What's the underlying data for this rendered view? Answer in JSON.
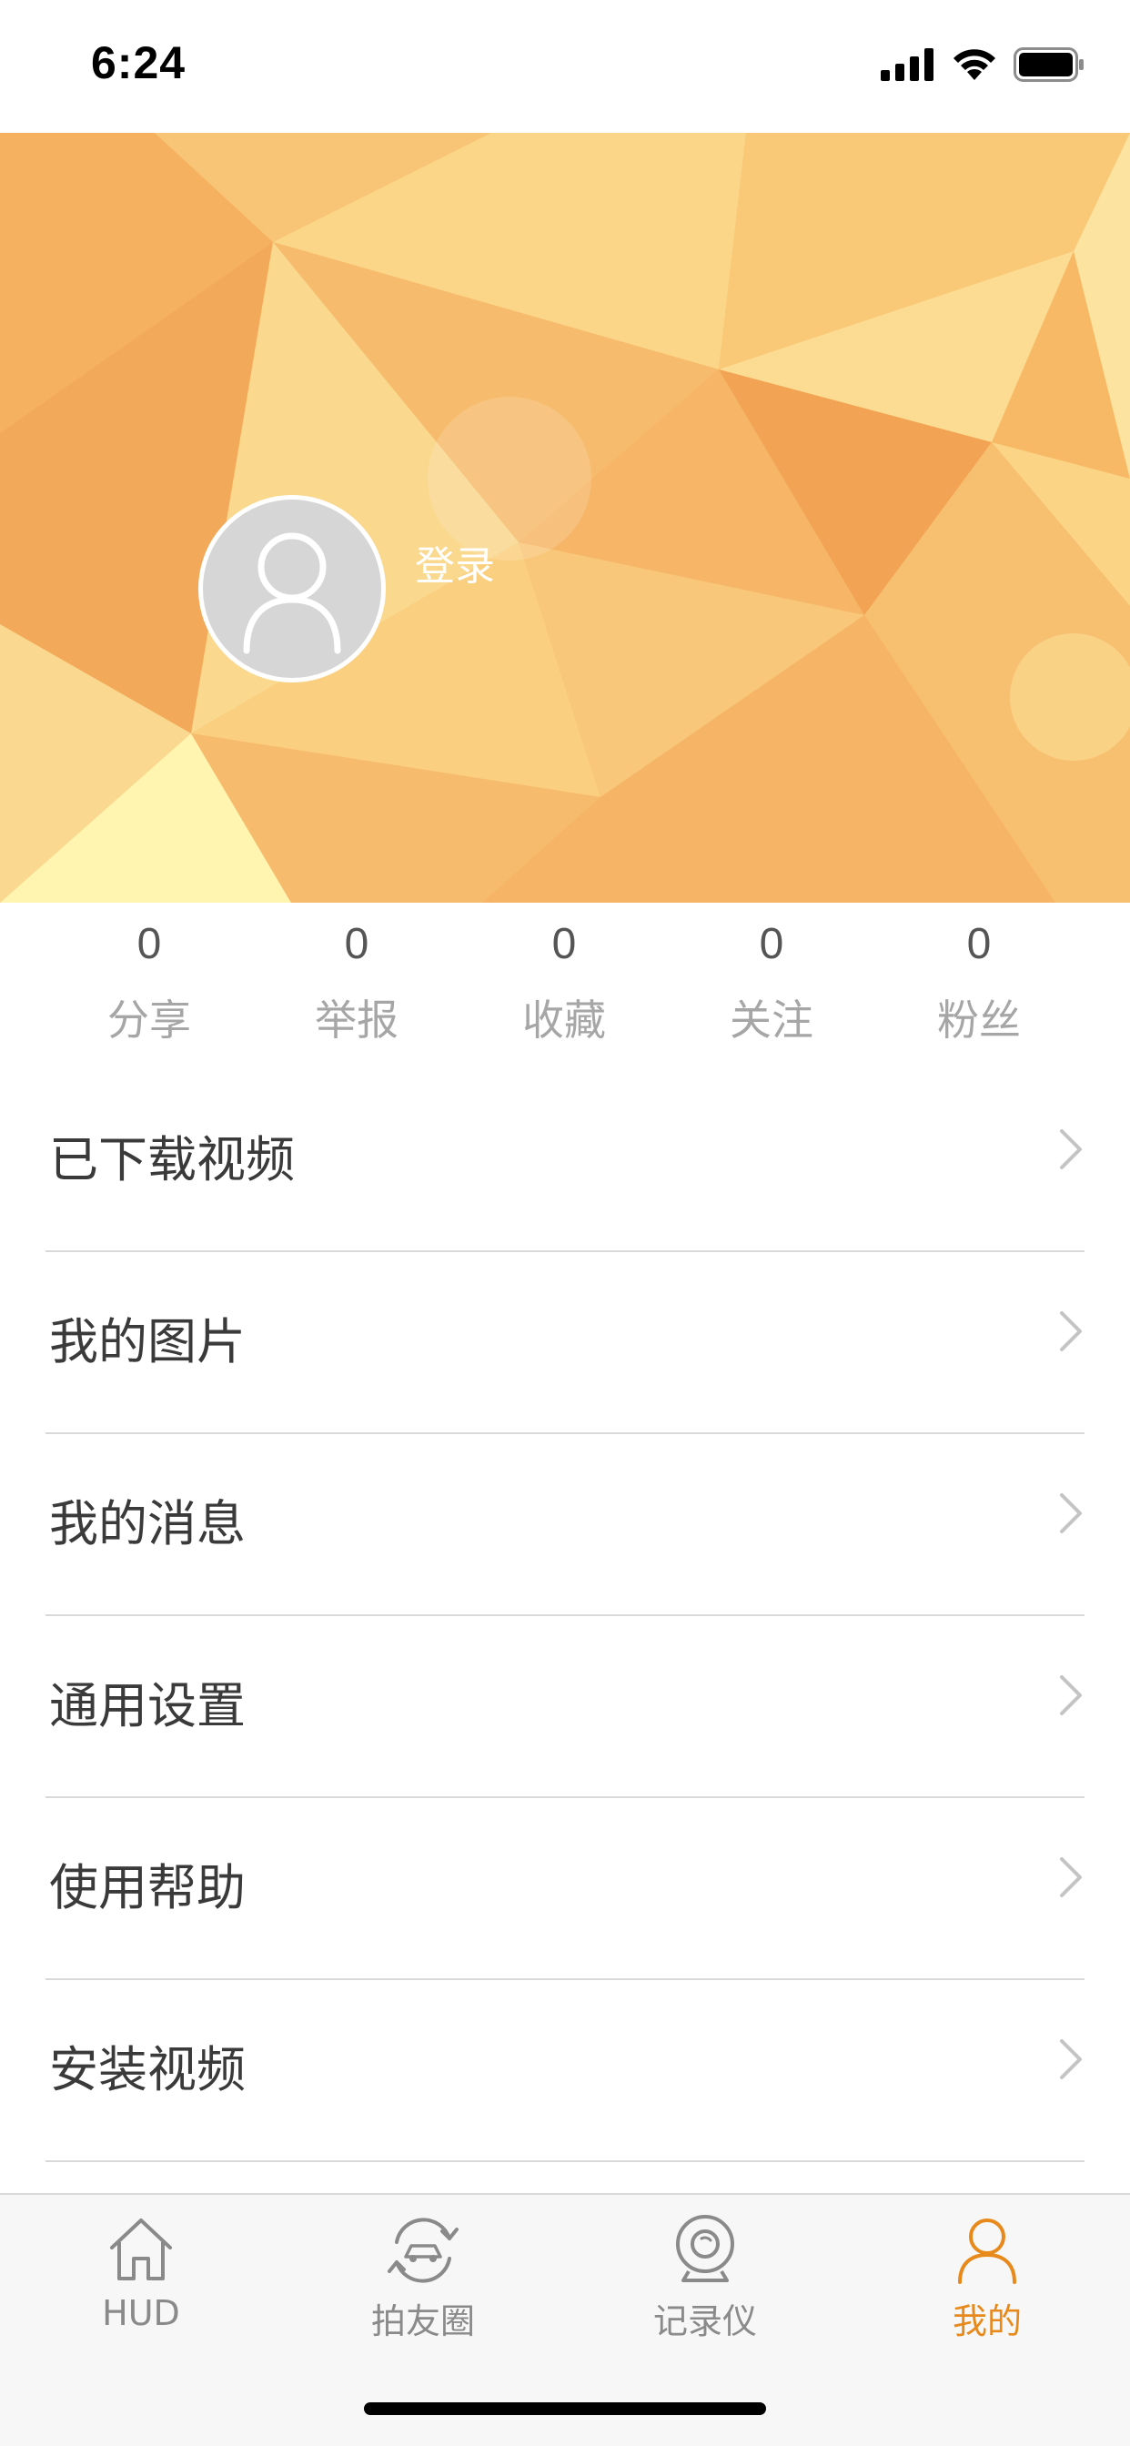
{
  "status_bar": {
    "time": "6:24",
    "icons": [
      "signal-icon",
      "wifi-icon",
      "battery-icon"
    ]
  },
  "profile": {
    "login_label": "登录",
    "avatar_icon": "user-avatar-icon"
  },
  "stats": [
    {
      "count": "0",
      "label": "分享"
    },
    {
      "count": "0",
      "label": "举报"
    },
    {
      "count": "0",
      "label": "收藏"
    },
    {
      "count": "0",
      "label": "关注"
    },
    {
      "count": "0",
      "label": "粉丝"
    }
  ],
  "menu": [
    {
      "label": "已下载视频"
    },
    {
      "label": "我的图片"
    },
    {
      "label": "我的消息"
    },
    {
      "label": "通用设置"
    },
    {
      "label": "使用帮助"
    },
    {
      "label": "安装视频"
    }
  ],
  "tabbar": {
    "tabs": [
      {
        "label": "HUD",
        "icon": "home-icon"
      },
      {
        "label": "拍友圈",
        "icon": "car-refresh-icon"
      },
      {
        "label": "记录仪",
        "icon": "dashcam-icon"
      },
      {
        "label": "我的",
        "icon": "person-icon"
      }
    ],
    "active_index": 3,
    "active_color": "#e8891b",
    "inactive_color": "#8a8a8a"
  },
  "colors": {
    "banner_base": "#f7b965",
    "banner_light": "#fde9a0",
    "banner_dark": "#f1a455"
  }
}
